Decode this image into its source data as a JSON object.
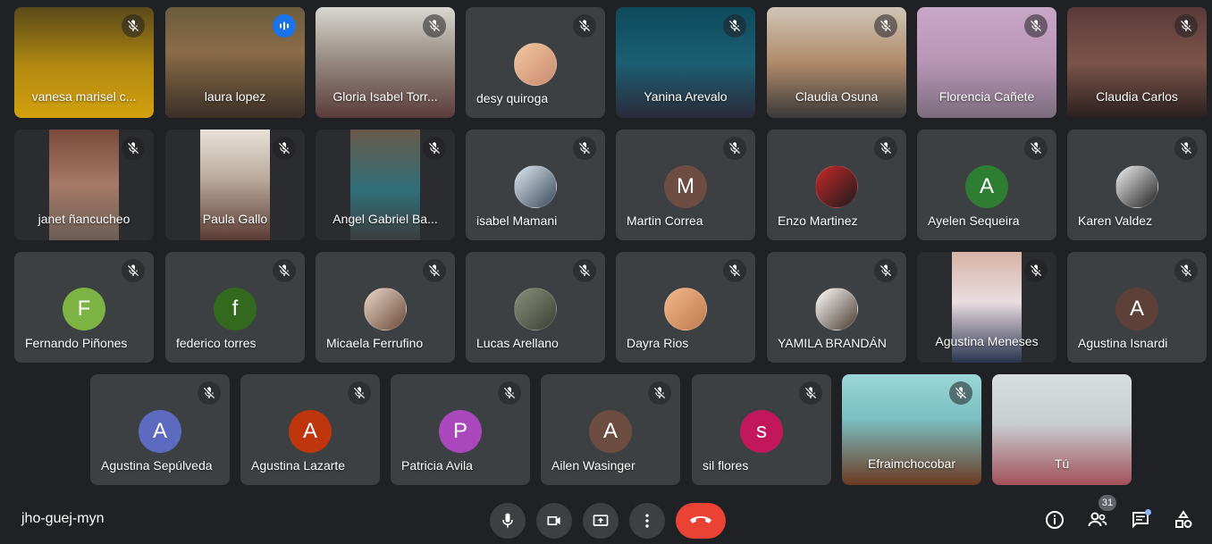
{
  "meeting": {
    "code": "jho-guej-myn",
    "participant_count": "31"
  },
  "colors": {
    "background": "#202124",
    "tile": "#3c4043",
    "speaking_outline": "#8ab4f8",
    "hangup": "#ea4335"
  },
  "tiles": [
    {
      "name": "vanesa marisel c...",
      "kind": "video",
      "bg": "linear-gradient(180deg,#5a4a1a 0%,#b48a10 55%,#d2a10f 100%)",
      "speaking": false
    },
    {
      "name": "laura lopez",
      "kind": "video",
      "bg": "linear-gradient(180deg,#6b5b3e 0%,#8a6c48 40%,#3b2f26 100%)",
      "speaking": true
    },
    {
      "name": "Gloria Isabel Torr...",
      "kind": "video",
      "bg": "linear-gradient(180deg,#d9d7d2 0%,#9a8f86 45%,#5a3b3b 100%)",
      "speaking": false
    },
    {
      "name": "desy quiroga",
      "kind": "photo",
      "avatar_bg": "linear-gradient(135deg,#f2c6a0,#c98b6e)"
    },
    {
      "name": "Yanina Arevalo",
      "kind": "video",
      "bg": "linear-gradient(180deg,#0e4a5c 0%,#1b5f73 50%,#2b2a3a 100%)",
      "speaking": false
    },
    {
      "name": "Claudia Osuna",
      "kind": "video",
      "bg": "linear-gradient(180deg,#cfc6b6 0%,#b08a6a 50%,#3a3a3a 100%)",
      "speaking": false
    },
    {
      "name": "Florencia Cañete",
      "kind": "video",
      "bg": "linear-gradient(180deg,#c9a7c8 0%,#b894b5 50%,#7b6d7d 100%)",
      "speaking": false
    },
    {
      "name": "Claudia Carlos",
      "kind": "video",
      "bg": "linear-gradient(180deg,#5a3a3a 0%,#7b5448 50%,#2a2020 100%)",
      "speaking": false
    },
    {
      "name": "janet ñancucheo",
      "kind": "video",
      "bg": "linear-gradient(180deg,#7a4a3a 0%,#a57a66 50%,#6b5d55 100%)",
      "speaking": false
    },
    {
      "name": "Paula Gallo",
      "kind": "video",
      "bg": "linear-gradient(180deg,#e8e2da 0%,#b9a99a 45%,#5b3b33 100%)",
      "speaking": false
    },
    {
      "name": "Angel Gabriel Ba...",
      "kind": "video",
      "bg": "linear-gradient(180deg,#6a5a4a 0%,#2f6f7a 55%,#3c3c3c 100%)",
      "speaking": false
    },
    {
      "name": "isabel Mamani",
      "kind": "photo",
      "avatar_bg": "linear-gradient(135deg,#dfe7ee,#3a4a5c)"
    },
    {
      "name": "Martin Correa",
      "kind": "letter",
      "letter": "M",
      "avatar_bg": "#6d4c41"
    },
    {
      "name": "Enzo Martinez",
      "kind": "photo",
      "avatar_bg": "linear-gradient(135deg,#c62828,#1b1b1b)"
    },
    {
      "name": "Ayelen Sequeira",
      "kind": "letter",
      "letter": "A",
      "avatar_bg": "#2e7d32"
    },
    {
      "name": "Karen Valdez",
      "kind": "photo",
      "avatar_bg": "linear-gradient(135deg,#f0f0f0,#222222)"
    },
    {
      "name": "Fernando Piñones",
      "kind": "letter",
      "letter": "F",
      "avatar_bg": "#7cb342"
    },
    {
      "name": "federico torres",
      "kind": "letter",
      "letter": "f",
      "avatar_bg": "#33691e"
    },
    {
      "name": "Micaela Ferrufino",
      "kind": "photo",
      "avatar_bg": "linear-gradient(135deg,#e9d6c6,#6b4a3a)"
    },
    {
      "name": "Lucas Arellano",
      "kind": "photo",
      "avatar_bg": "linear-gradient(135deg,#8a8f7a,#3a3f35)"
    },
    {
      "name": "Dayra Rios",
      "kind": "photo",
      "avatar_bg": "linear-gradient(135deg,#f0b88a,#c07a50)"
    },
    {
      "name": "YAMILA BRANDÁN",
      "kind": "photo",
      "avatar_bg": "linear-gradient(135deg,#ffffff,#4a3a30)"
    },
    {
      "name": "Agustina Meneses",
      "kind": "video",
      "bg": "linear-gradient(180deg,#d8b3a6 0%,#e9dde0 45%,#2b3350 100%)",
      "speaking": false
    },
    {
      "name": "Agustina Isnardi",
      "kind": "letter",
      "letter": "A",
      "avatar_bg": "#5d4037"
    },
    {
      "name": "Agustina Sepúlveda",
      "kind": "letter",
      "letter": "A",
      "avatar_bg": "#5c6bc0"
    },
    {
      "name": "Agustina Lazarte",
      "kind": "letter",
      "letter": "A",
      "avatar_bg": "#bf360c"
    },
    {
      "name": "Patricia Avila",
      "kind": "letter",
      "letter": "P",
      "avatar_bg": "#ab47bc"
    },
    {
      "name": "Ailen Wasinger",
      "kind": "letter",
      "letter": "A",
      "avatar_bg": "#6d4c41"
    },
    {
      "name": "sil flores",
      "kind": "letter",
      "letter": "s",
      "avatar_bg": "#c2185b"
    },
    {
      "name": "Efraimchocobar",
      "kind": "video",
      "bg": "linear-gradient(180deg,#9ad6d8 0%,#7bbfc2 40%,#6b3a22 100%)",
      "speaking": false,
      "full": true
    },
    {
      "name": "Tú",
      "kind": "self",
      "bg": "linear-gradient(180deg,#d8dde0 0%,#c8cdd0 45%,#a2505a 100%)",
      "full": true
    }
  ],
  "icons": {
    "mic": "microphone-icon",
    "camera": "camera-icon",
    "present": "present-screen-icon",
    "more": "more-options-icon",
    "hangup": "hang-up-icon",
    "info": "info-icon",
    "people": "people-icon",
    "chat": "chat-icon",
    "activities": "activities-icon"
  }
}
